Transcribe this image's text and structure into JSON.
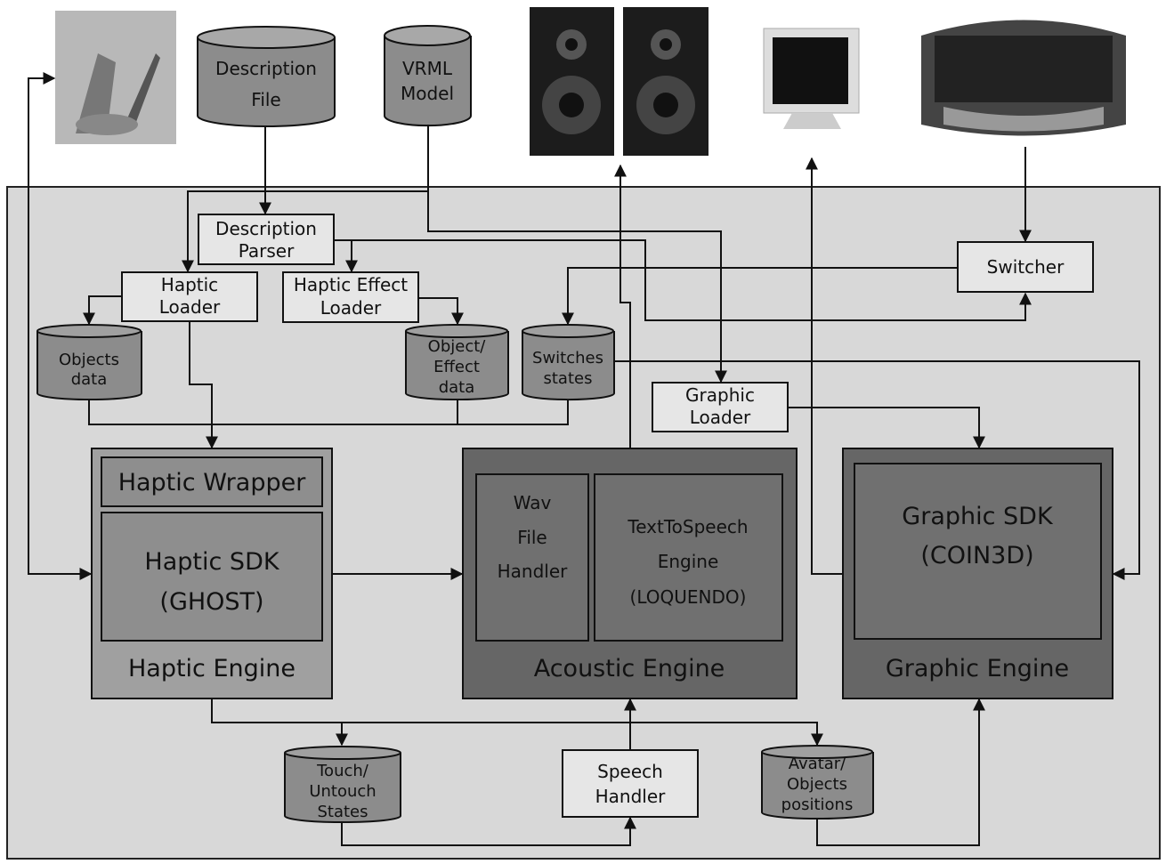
{
  "external": {
    "description_file": [
      "Description",
      "File"
    ],
    "vrml_model": [
      "VRML",
      "Model"
    ],
    "icons": [
      "haptic-device-image",
      "speakers-image",
      "monitor-image",
      "keyboard-image"
    ]
  },
  "modules": {
    "description_parser": [
      "Description",
      "Parser"
    ],
    "haptic_loader": [
      "Haptic",
      "Loader"
    ],
    "haptic_effect_loader": [
      "Haptic Effect",
      "Loader"
    ],
    "switcher": "Switcher",
    "graphic_loader": [
      "Graphic",
      "Loader"
    ],
    "speech_handler": [
      "Speech",
      "Handler"
    ]
  },
  "data_stores": {
    "objects_data": [
      "Objects",
      "data"
    ],
    "object_effect_data": [
      "Object/",
      "Effect",
      "data"
    ],
    "switches_states": [
      "Switches",
      "states"
    ],
    "touch_states": [
      "Touch/",
      "Untouch",
      "States"
    ],
    "avatar_positions": [
      "Avatar/",
      "Objects",
      "positions"
    ]
  },
  "engines": {
    "haptic": {
      "title": "Haptic Engine",
      "wrapper": "Haptic Wrapper",
      "sdk": [
        "Haptic SDK",
        "(GHOST)"
      ]
    },
    "acoustic": {
      "title": "Acoustic Engine",
      "wav": [
        "Wav",
        "File",
        "Handler"
      ],
      "tts": [
        "TextToSpeech",
        "Engine",
        "(LOQUENDO)"
      ]
    },
    "graphic": {
      "title": "Graphic Engine",
      "sdk": [
        "Graphic SDK",
        "(COIN3D)"
      ]
    }
  },
  "colors": {
    "panel": "#d8d8d8",
    "store": "#8c8c8c",
    "haptic_engine": "#a0a0a0",
    "dark_engine": "#666666"
  }
}
